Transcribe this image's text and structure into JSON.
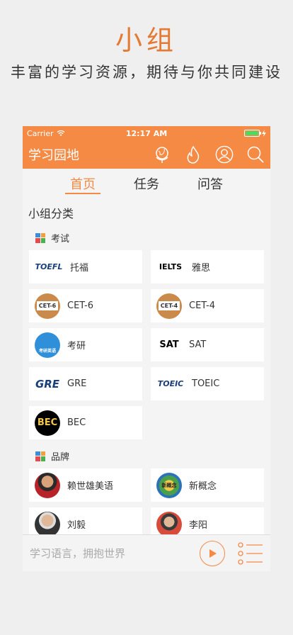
{
  "hero": {
    "title": "小组",
    "subtitle": "丰富的学习资源，期待与你共同建设"
  },
  "status": {
    "carrier": "Carrier",
    "time": "12:17 AM"
  },
  "navbar": {
    "title": "学习园地",
    "icons": [
      "globe-icon",
      "fire-icon",
      "profile-icon",
      "search-icon"
    ]
  },
  "tabs": [
    {
      "label": "首页",
      "active": true
    },
    {
      "label": "任务",
      "active": false
    },
    {
      "label": "问答",
      "active": false
    }
  ],
  "section_title": "小组分类",
  "categories": [
    {
      "name": "考试",
      "items": [
        {
          "label": "托福",
          "logo_text": "TOEFL"
        },
        {
          "label": "雅思",
          "logo_text": "IELTS"
        },
        {
          "label": "CET-6",
          "logo_text": "CET-6"
        },
        {
          "label": "CET-4",
          "logo_text": "CET-4"
        },
        {
          "label": "考研",
          "logo_text": "考研英语"
        },
        {
          "label": "SAT",
          "logo_text": "SAT"
        },
        {
          "label": "GRE",
          "logo_text": "GRE"
        },
        {
          "label": "TOEIC",
          "logo_text": "TOEIC"
        },
        {
          "label": "BEC",
          "logo_text": "BEC"
        }
      ]
    },
    {
      "name": "品牌",
      "items": [
        {
          "label": "赖世雄美语"
        },
        {
          "label": "新概念",
          "logo_text": "新概念"
        },
        {
          "label": "刘毅"
        },
        {
          "label": "李阳"
        }
      ]
    }
  ],
  "bottombar": {
    "slogan": "学习语言，拥抱世界"
  },
  "colors": {
    "accent": "#f58a45",
    "hero_title": "#e47a33"
  }
}
